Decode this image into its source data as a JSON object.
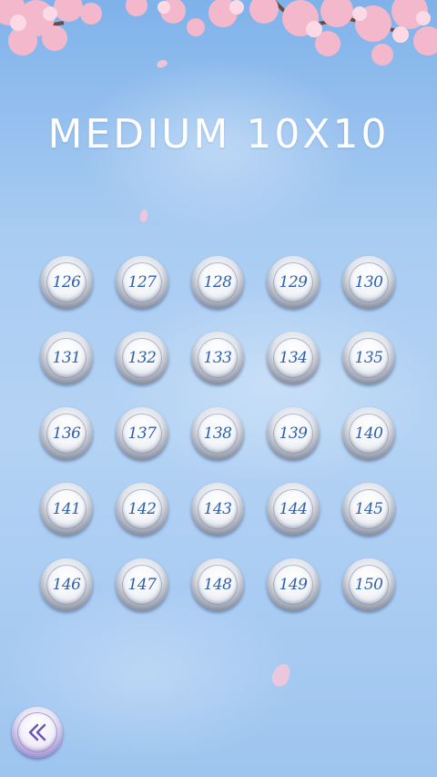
{
  "screen": {
    "title": "MEDIUM 10X10"
  },
  "levels": [
    "126",
    "127",
    "128",
    "129",
    "130",
    "131",
    "132",
    "133",
    "134",
    "135",
    "136",
    "137",
    "138",
    "139",
    "140",
    "141",
    "142",
    "143",
    "144",
    "145",
    "146",
    "147",
    "148",
    "149",
    "150"
  ],
  "back_button": {
    "icon": "double-chevron-left-icon"
  },
  "colors": {
    "sky_top": "#7fb2ea",
    "sky_mid": "#b4d3f4",
    "level_number": "#2d5fb0",
    "title": "#ffffff",
    "blossom": "#f6c7d8",
    "back_button_rim": "#7a63c0"
  }
}
